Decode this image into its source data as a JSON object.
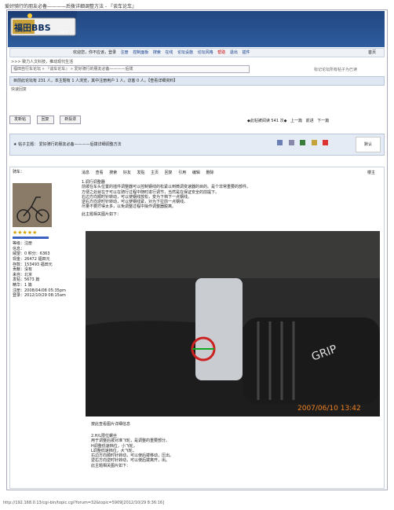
{
  "page_title": "爱好骑行的朋友必备————后拨详细调整方法 - 『谈车论车』",
  "logo_text": "福田BBS",
  "logo_sub": "NET",
  "nav": {
    "items": [
      "欢迎您，你不应该，登录 ",
      "注册",
      "控制面板",
      "搜索",
      "在线",
      "论坛设施",
      "论坛风格",
      "帮助",
      "退出",
      "插件"
    ],
    "home": "首页"
  },
  "notice": ">>> 致力人文科技，推动现代生活",
  "breadcrumb": "福田自行车论坛 » 『谈车论车』 » 爱好骑行的朋友必备————后拨",
  "breadcrumb_right": "标记论坛所有帖子为已读",
  "status": "目前此论坛有 231 人，本主题有 1 人浏览，其中注册用户 1 人，访客 0 人。【查看详细资料】",
  "unread": "快速回复",
  "buttons": [
    "发新帖",
    "回复",
    "新投票"
  ],
  "pager": [
    "◆此帖被阅读 541 次◆",
    "上一篇",
    "前进",
    "下一篇"
  ],
  "topic_title": "★ 帖子主题： 爱好骑行的朋友必备————后拨详细调整方法",
  "topic_right": "默认",
  "user": {
    "name": "骑车：",
    "level": "等级：注册",
    "info": [
      "信息：",
      "威望：0 积分：6363",
      "现金：26472 福田元",
      "存款：153493 福田元",
      "贡献：没有",
      "来自：北京",
      "发帖：5673 篇",
      "精华：1 篇",
      "注册：2008/04/08 05:35pm",
      "登录：2012/10/29 08:15am"
    ]
  },
  "post_actions": [
    "消息",
    "查看",
    "搜索",
    "好友",
    "发贴",
    "主页",
    "回复",
    "引用",
    "编辑",
    "删除"
  ],
  "post_right": "楼主",
  "post_text": [
    "1.调行调整器",
    "前拨在车头位置的插件调整器可以控制钢线的松紧以到微调变速器的目的。是个非常重要的部件。",
    "方便之处就在于可以在骑行过程中随时进行调节，当然是在保证安全的前提下。",
    "右边方向顺时针转动，可以使钢线放松，变为下档下一点钢线。",
    "逆右方向逆时针转动，可以使钢线紧，对为下拉前一点钢线。",
    "尽量不要拧得太多，以免调整过程中操作调整器脱离。"
  ],
  "img_label": "此主题相关图片如下：",
  "caption": "按此查看图片详细信息",
  "post_text2": [
    "2.H/L限位螺丝",
    "用于调整后拨对准飞轮，是调整的重要部分。",
    "H调整低速档位，小飞轮，",
    "L调整低速档位，大飞轮，",
    "右边方向顺时针转动，可以使后拨移动，压出。",
    "逆右方向逆时针转动，可以使后拨离开，出。",
    "",
    "此主题相关图片如下："
  ],
  "photo_date": "2007/06/10 13:42",
  "footer": "http://192.168.0.13/cgi-bin/topic.cgi?forum=32&topic=5909[2012/10/29 8:36:16]",
  "colors": {
    "header": "#1b3d73",
    "accent": "#3c62c1",
    "border": "#b9c6d9"
  }
}
